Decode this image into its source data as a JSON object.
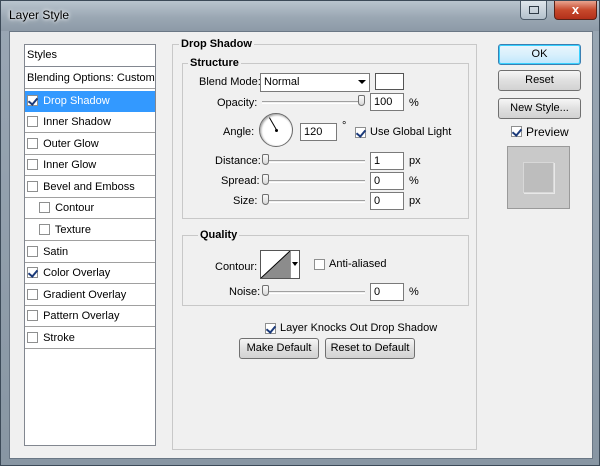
{
  "window": {
    "title": "Layer Style",
    "close_label": "x"
  },
  "styles_panel": {
    "header": "Styles",
    "blending": "Blending Options: Custom",
    "items": [
      {
        "label": "Drop Shadow",
        "checked": true,
        "selected": true
      },
      {
        "label": "Inner Shadow",
        "checked": false
      },
      {
        "label": "Outer Glow",
        "checked": false
      },
      {
        "label": "Inner Glow",
        "checked": false
      },
      {
        "label": "Bevel and Emboss",
        "checked": false
      },
      {
        "label": "Contour",
        "checked": false
      },
      {
        "label": "Texture",
        "checked": false
      },
      {
        "label": "Satin",
        "checked": false
      },
      {
        "label": "Color Overlay",
        "checked": true
      },
      {
        "label": "Gradient Overlay",
        "checked": false
      },
      {
        "label": "Pattern Overlay",
        "checked": false
      },
      {
        "label": "Stroke",
        "checked": false
      }
    ]
  },
  "drop_shadow": {
    "title": "Drop Shadow",
    "structure": {
      "title": "Structure",
      "blend_mode_label": "Blend Mode:",
      "blend_mode_value": "Normal",
      "color": "#ffffff",
      "opacity_label": "Opacity:",
      "opacity_value": "100",
      "opacity_fraction": 1.0,
      "angle_label": "Angle:",
      "angle_value": "120",
      "angle_unit": "°",
      "use_global_light_label": "Use Global Light",
      "use_global_light": true,
      "distance_label": "Distance:",
      "distance_value": "1",
      "distance_fraction": 0.0,
      "spread_label": "Spread:",
      "spread_value": "0",
      "spread_fraction": 0.0,
      "size_label": "Size:",
      "size_value": "0",
      "size_fraction": 0.0,
      "unit_percent": "%",
      "unit_px": "px"
    },
    "quality": {
      "title": "Quality",
      "contour_label": "Contour:",
      "anti_aliased_label": "Anti-aliased",
      "anti_aliased": false,
      "noise_label": "Noise:",
      "noise_value": "0",
      "noise_fraction": 0.0,
      "unit_percent": "%"
    },
    "knocks_out_label": "Layer Knocks Out Drop Shadow",
    "knocks_out": true,
    "make_default_label": "Make Default",
    "reset_default_label": "Reset to Default"
  },
  "buttons": {
    "ok": "OK",
    "reset": "Reset",
    "new_style": "New Style...",
    "preview_label": "Preview",
    "preview_checked": true
  }
}
